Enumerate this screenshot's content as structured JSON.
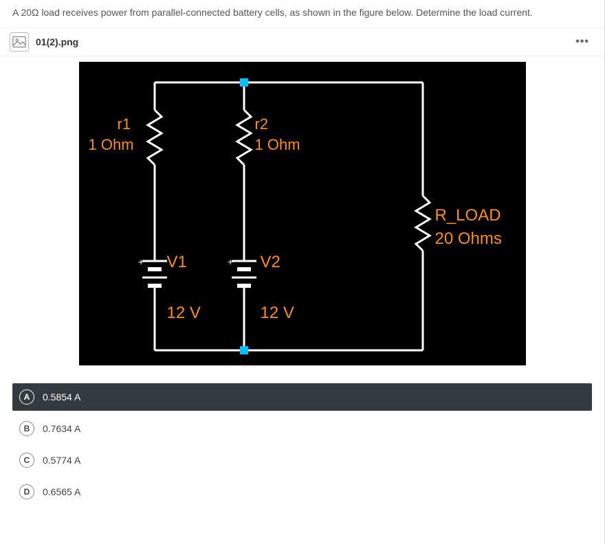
{
  "question": "A 20Ω load receives power from parallel-connected battery cells, as shown in the figure below. Determine the load current.",
  "attachment": {
    "filename": "01(2).png"
  },
  "circuit": {
    "r1": {
      "name": "r1",
      "value": "1 Ohm"
    },
    "r2": {
      "name": "r2",
      "value": "1 Ohm"
    },
    "v1": {
      "name": "V1",
      "value": "12 V"
    },
    "v2": {
      "name": "V2",
      "value": "12 V"
    },
    "rload": {
      "name": "R_LOAD",
      "value": "20 Ohms"
    }
  },
  "options": {
    "a": {
      "letter": "A",
      "text": "0.5854 A"
    },
    "b": {
      "letter": "B",
      "text": "0.7634 A"
    },
    "c": {
      "letter": "C",
      "text": "0.5774 A"
    },
    "d": {
      "letter": "D",
      "text": "0.6565 A"
    }
  },
  "selected_option": "a"
}
